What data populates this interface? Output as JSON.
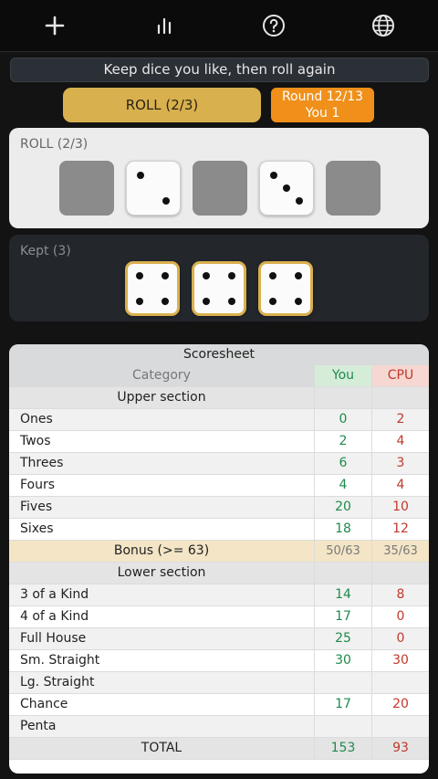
{
  "toolbar": {
    "icons": [
      "plus-icon",
      "bar-chart-icon",
      "help-icon",
      "globe-icon"
    ]
  },
  "hint": "Keep dice you like, then roll again",
  "roll_button": "ROLL (2/3)",
  "round": {
    "line1": "Round 12/13",
    "line2": "You 1"
  },
  "roll_panel": {
    "label": "ROLL (2/3)",
    "dice": [
      null,
      2,
      null,
      3,
      null
    ]
  },
  "kept_panel": {
    "label": "Kept (3)",
    "dice": [
      4,
      4,
      4
    ]
  },
  "scoresheet": {
    "title": "Scoresheet",
    "header": {
      "category": "Category",
      "you": "You",
      "cpu": "CPU"
    },
    "upper_title": "Upper section",
    "upper": [
      {
        "name": "Ones",
        "you": "0",
        "cpu": "2"
      },
      {
        "name": "Twos",
        "you": "2",
        "cpu": "4"
      },
      {
        "name": "Threes",
        "you": "6",
        "cpu": "3"
      },
      {
        "name": "Fours",
        "you": "4",
        "cpu": "4"
      },
      {
        "name": "Fives",
        "you": "20",
        "cpu": "10"
      },
      {
        "name": "Sixes",
        "you": "18",
        "cpu": "12"
      }
    ],
    "bonus": {
      "name": "Bonus (>= 63)",
      "you": "50/63",
      "cpu": "35/63"
    },
    "lower_title": "Lower section",
    "lower": [
      {
        "name": "3 of a Kind",
        "you": "14",
        "cpu": "8"
      },
      {
        "name": "4 of a Kind",
        "you": "17",
        "cpu": "0"
      },
      {
        "name": "Full House",
        "you": "25",
        "cpu": "0"
      },
      {
        "name": "Sm. Straight",
        "you": "30",
        "cpu": "30"
      },
      {
        "name": "Lg. Straight",
        "you": "",
        "cpu": ""
      },
      {
        "name": "Chance",
        "you": "17",
        "cpu": "20"
      },
      {
        "name": "Penta",
        "you": "",
        "cpu": ""
      }
    ],
    "total": {
      "name": "TOTAL",
      "you": "153",
      "cpu": "93"
    }
  },
  "colors": {
    "accent_gold": "#d9b04e",
    "round_orange": "#f0901a",
    "you_green": "#1f8a4c",
    "cpu_red": "#c0392b"
  }
}
